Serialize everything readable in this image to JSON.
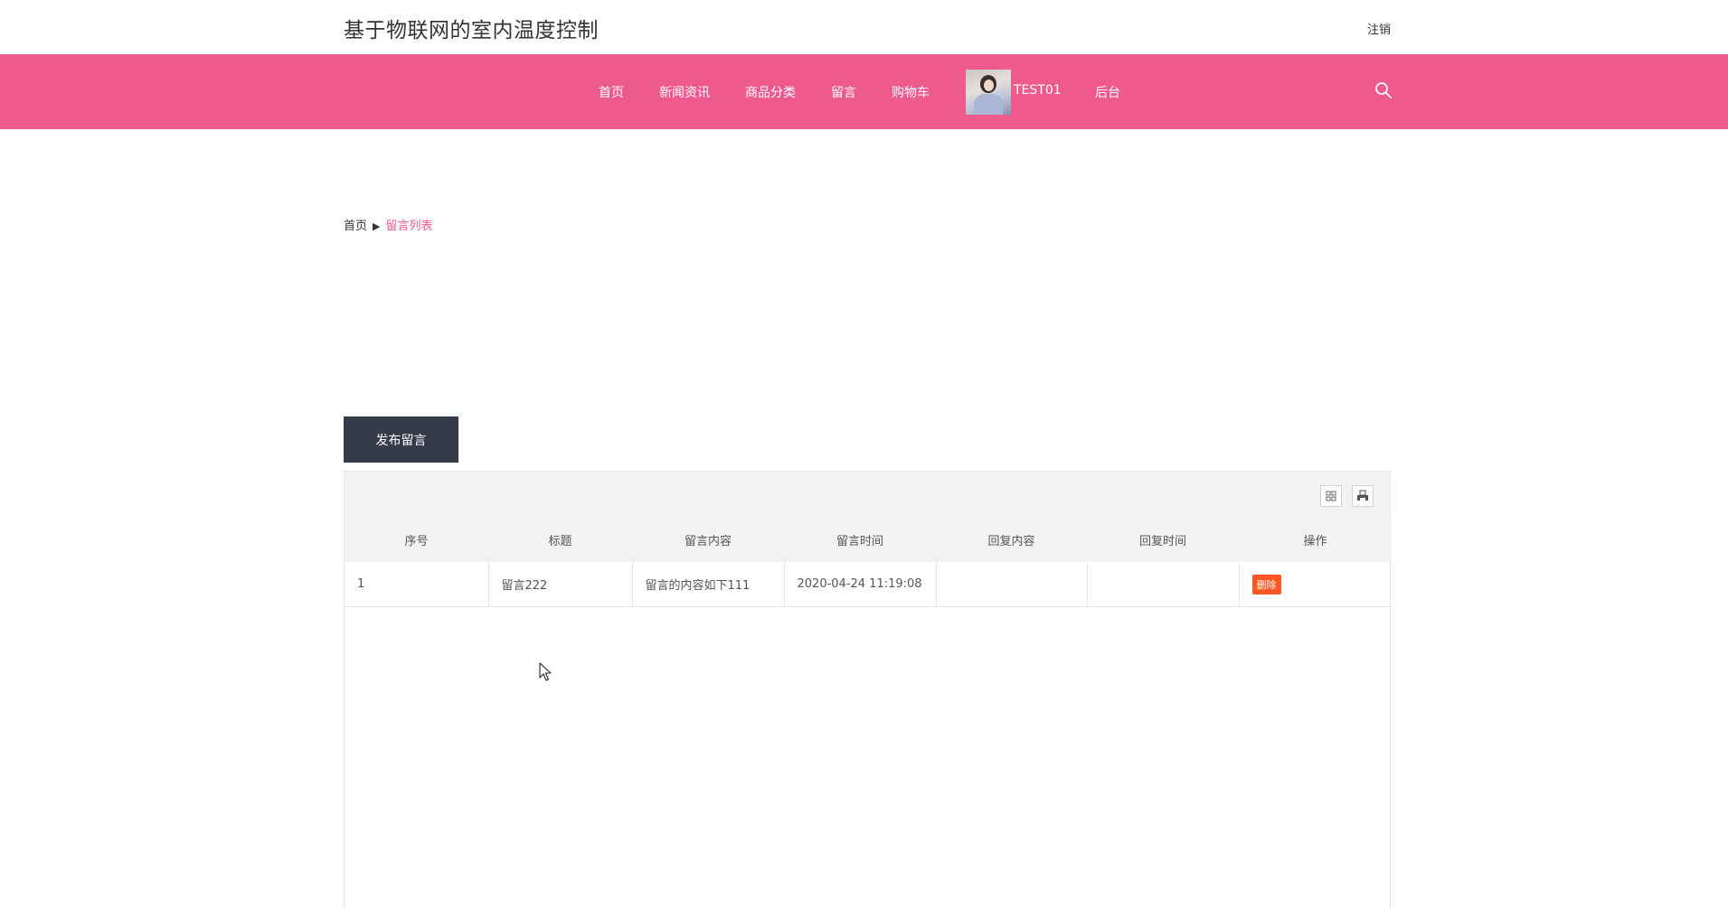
{
  "header": {
    "site_title": "基于物联网的室内温度控制",
    "logout_label": "注销"
  },
  "nav": {
    "items": [
      {
        "label": "首页"
      },
      {
        "label": "新闻资讯"
      },
      {
        "label": "商品分类"
      },
      {
        "label": "留言"
      },
      {
        "label": "购物车"
      }
    ],
    "username": "TEST01",
    "admin_label": "后台",
    "search_icon": "search-icon"
  },
  "colors": {
    "nav_bg": "#ef5a8e",
    "button_dark": "#353b4a",
    "delete_btn": "#ff5722"
  },
  "breadcrumb": {
    "home": "首页",
    "separator": "▶",
    "current": "留言列表"
  },
  "post_button_label": "发布留言",
  "toolbar": {
    "columns_icon": "columns-filter-icon",
    "print_icon": "print-icon"
  },
  "table": {
    "columns": [
      "序号",
      "标题",
      "留言内容",
      "留言时间",
      "回复内容",
      "回复时间",
      "操作"
    ],
    "rows": [
      {
        "index": "1",
        "title": "留言222",
        "content": "留言的内容如下111",
        "time": "2020-04-24 11:19:08",
        "reply_content": "",
        "reply_time": "",
        "action_label": "删除"
      }
    ]
  }
}
